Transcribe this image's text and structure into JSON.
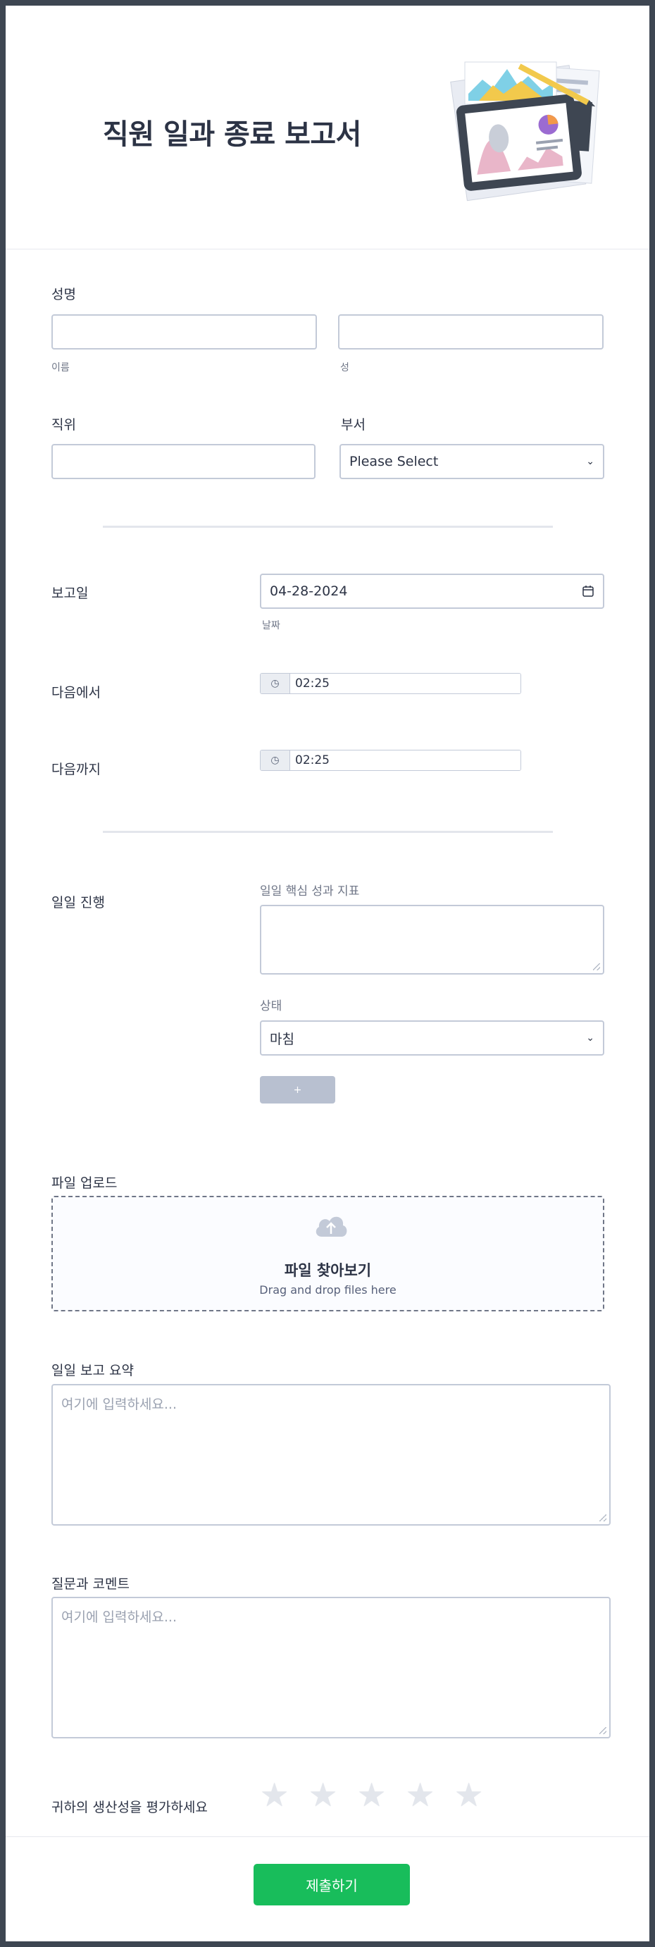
{
  "header": {
    "title": "직원 일과 종료 보고서",
    "illustration": "report-illustration"
  },
  "name": {
    "label": "성명",
    "first_sublabel": "이름",
    "last_sublabel": "성",
    "first_value": "",
    "last_value": ""
  },
  "position": {
    "label": "직위",
    "value": ""
  },
  "department": {
    "label": "부서",
    "selected": "Please Select"
  },
  "report_date": {
    "label": "보고일",
    "value": "04-28-2024",
    "sublabel": "날짜",
    "icon": "calendar-icon"
  },
  "from_time": {
    "label": "다음에서",
    "value": "02:25",
    "icon": "clock-icon"
  },
  "to_time": {
    "label": "다음까지",
    "value": "02:25",
    "icon": "clock-icon"
  },
  "progress": {
    "label": "일일 진행",
    "kpi_label": "일일 핵심 성과 지표",
    "kpi_value": "",
    "status_label": "상태",
    "status_selected": "마침",
    "add_label": "+"
  },
  "file_upload": {
    "label": "파일 업로드",
    "browse": "파일 찾아보기",
    "hint": "Drag and drop files here",
    "icon": "cloud-upload-icon"
  },
  "summary": {
    "label": "일일 보고 요약",
    "placeholder": "여기에 입력하세요..."
  },
  "questions": {
    "label": "질문과 코멘트",
    "placeholder": "여기에 입력하세요..."
  },
  "rating": {
    "label": "귀하의 생산성을 평가하세요",
    "max": 5,
    "value": 0,
    "star": "★"
  },
  "submit": {
    "label": "제출하기"
  },
  "colors": {
    "accent": "#18bd5b",
    "border": "#c3cad8",
    "frame": "#3e4652"
  }
}
